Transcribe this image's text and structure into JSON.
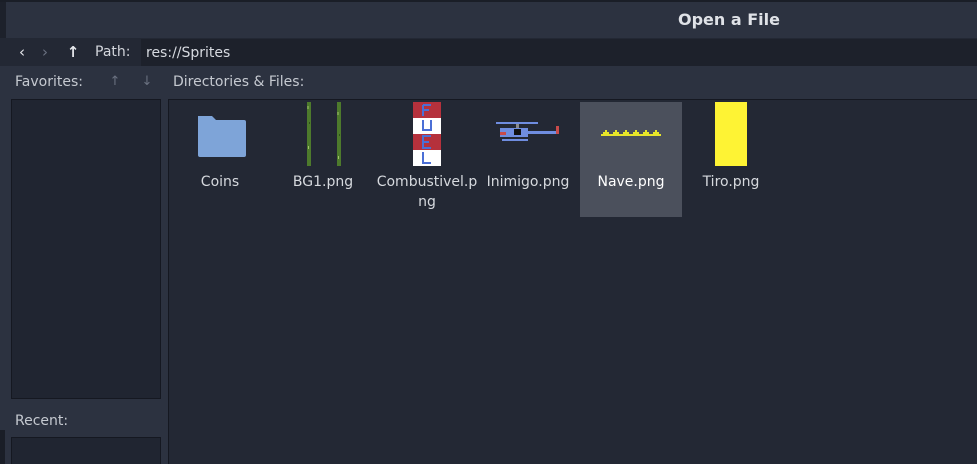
{
  "dialog": {
    "title": "Open a File"
  },
  "nav": {
    "back_icon": "‹",
    "forward_icon": "›",
    "up_icon": "↑",
    "path_label": "Path:",
    "path_value": "res://Sprites"
  },
  "favorites": {
    "label": "Favorites:",
    "move_up_icon": "↑",
    "move_down_icon": "↓"
  },
  "recent": {
    "label": "Recent:"
  },
  "files": {
    "label": "Directories & Files:",
    "items": [
      {
        "name": "Coins",
        "type": "folder-icon"
      },
      {
        "name": "BG1.png",
        "type": "image"
      },
      {
        "name": "Combustivel.png",
        "type": "image"
      },
      {
        "name": "Inimigo.png",
        "type": "image"
      },
      {
        "name": "Nave.png",
        "type": "image",
        "selected": true
      },
      {
        "name": "Tiro.png",
        "type": "image"
      }
    ]
  },
  "colors": {
    "panel_bg": "#2c3240",
    "list_bg": "#232834",
    "selection": "#4b505c",
    "folder": "#7ea4d8",
    "fuel_red": "#b5313c",
    "fuel_letter": "#4b6fd6",
    "ship_yellow": "#e8e62a",
    "shot_yellow": "#fef334",
    "bg_green": "#4d7a2c"
  }
}
